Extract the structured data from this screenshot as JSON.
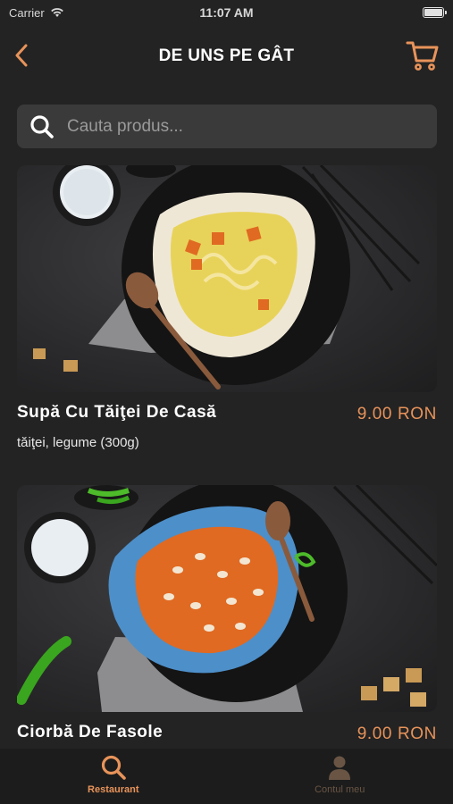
{
  "status_bar": {
    "carrier": "Carrier",
    "time": "11:07 AM"
  },
  "nav": {
    "title": "DE UNS PE GÂT"
  },
  "search": {
    "placeholder": "Cauta produs..."
  },
  "products": [
    {
      "name": "Supă Cu Tăiţei De Casă",
      "description": "tăiţei, legume (300g)",
      "price": "9.00  RON"
    },
    {
      "name": "Ciorbă De Fasole",
      "description": "",
      "price": "9.00  RON"
    }
  ],
  "tabs": [
    {
      "label": "Restaurant",
      "icon": "search-icon",
      "active": true
    },
    {
      "label": "Contul meu",
      "icon": "user-icon",
      "active": false
    }
  ],
  "colors": {
    "accent": "#e8935a",
    "background": "#232323",
    "search_bg": "#3a3a3a",
    "tabbar_bg": "#1c1c1c"
  }
}
